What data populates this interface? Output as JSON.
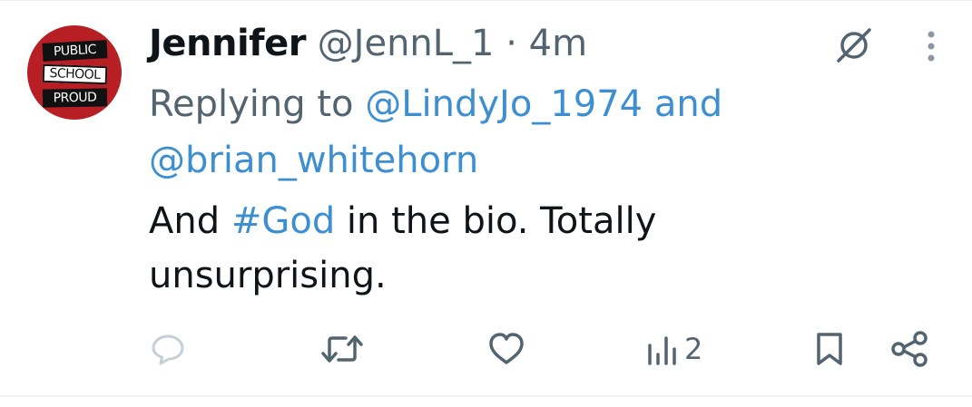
{
  "avatar": {
    "lines": [
      "PUBLIC",
      "SCHOOL",
      "PROUD"
    ],
    "colors": {
      "background": "#b71f25",
      "strip": "#111111"
    }
  },
  "header": {
    "name": "Jennifer",
    "handle": "@JennL_1",
    "separator": "·",
    "time": "4m"
  },
  "replying": {
    "prefix": "Replying to",
    "mention1": "@LindyJo_1974",
    "conjunction": "and",
    "mention2": "@brian_whitehorn"
  },
  "body": {
    "text_before": "And",
    "hashtag": "#God",
    "text_after": "in the bio. Totally unsurprising."
  },
  "actions": {
    "reply_icon": "reply-bubble-icon",
    "retweet_icon": "retweet-icon",
    "like_icon": "heart-icon",
    "views_icon": "views-chart-icon",
    "views_count": "2",
    "bookmark_icon": "bookmark-icon",
    "share_icon": "share-icon"
  },
  "colors": {
    "text": "#0f1419",
    "muted": "#536471",
    "link": "#3d8fd1",
    "reply_icon_faded": "#c4cfd6"
  }
}
